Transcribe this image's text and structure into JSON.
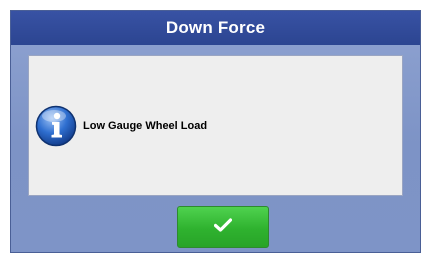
{
  "dialog": {
    "title": "Down Force",
    "message": "Low Gauge Wheel Load",
    "icon": "info-icon",
    "confirm_icon": "checkmark-icon"
  },
  "colors": {
    "title_bar": "#3852a4",
    "dialog_body": "#8fa3d1",
    "message_panel": "#eeeeee",
    "confirm_button": "#2fb22f"
  }
}
